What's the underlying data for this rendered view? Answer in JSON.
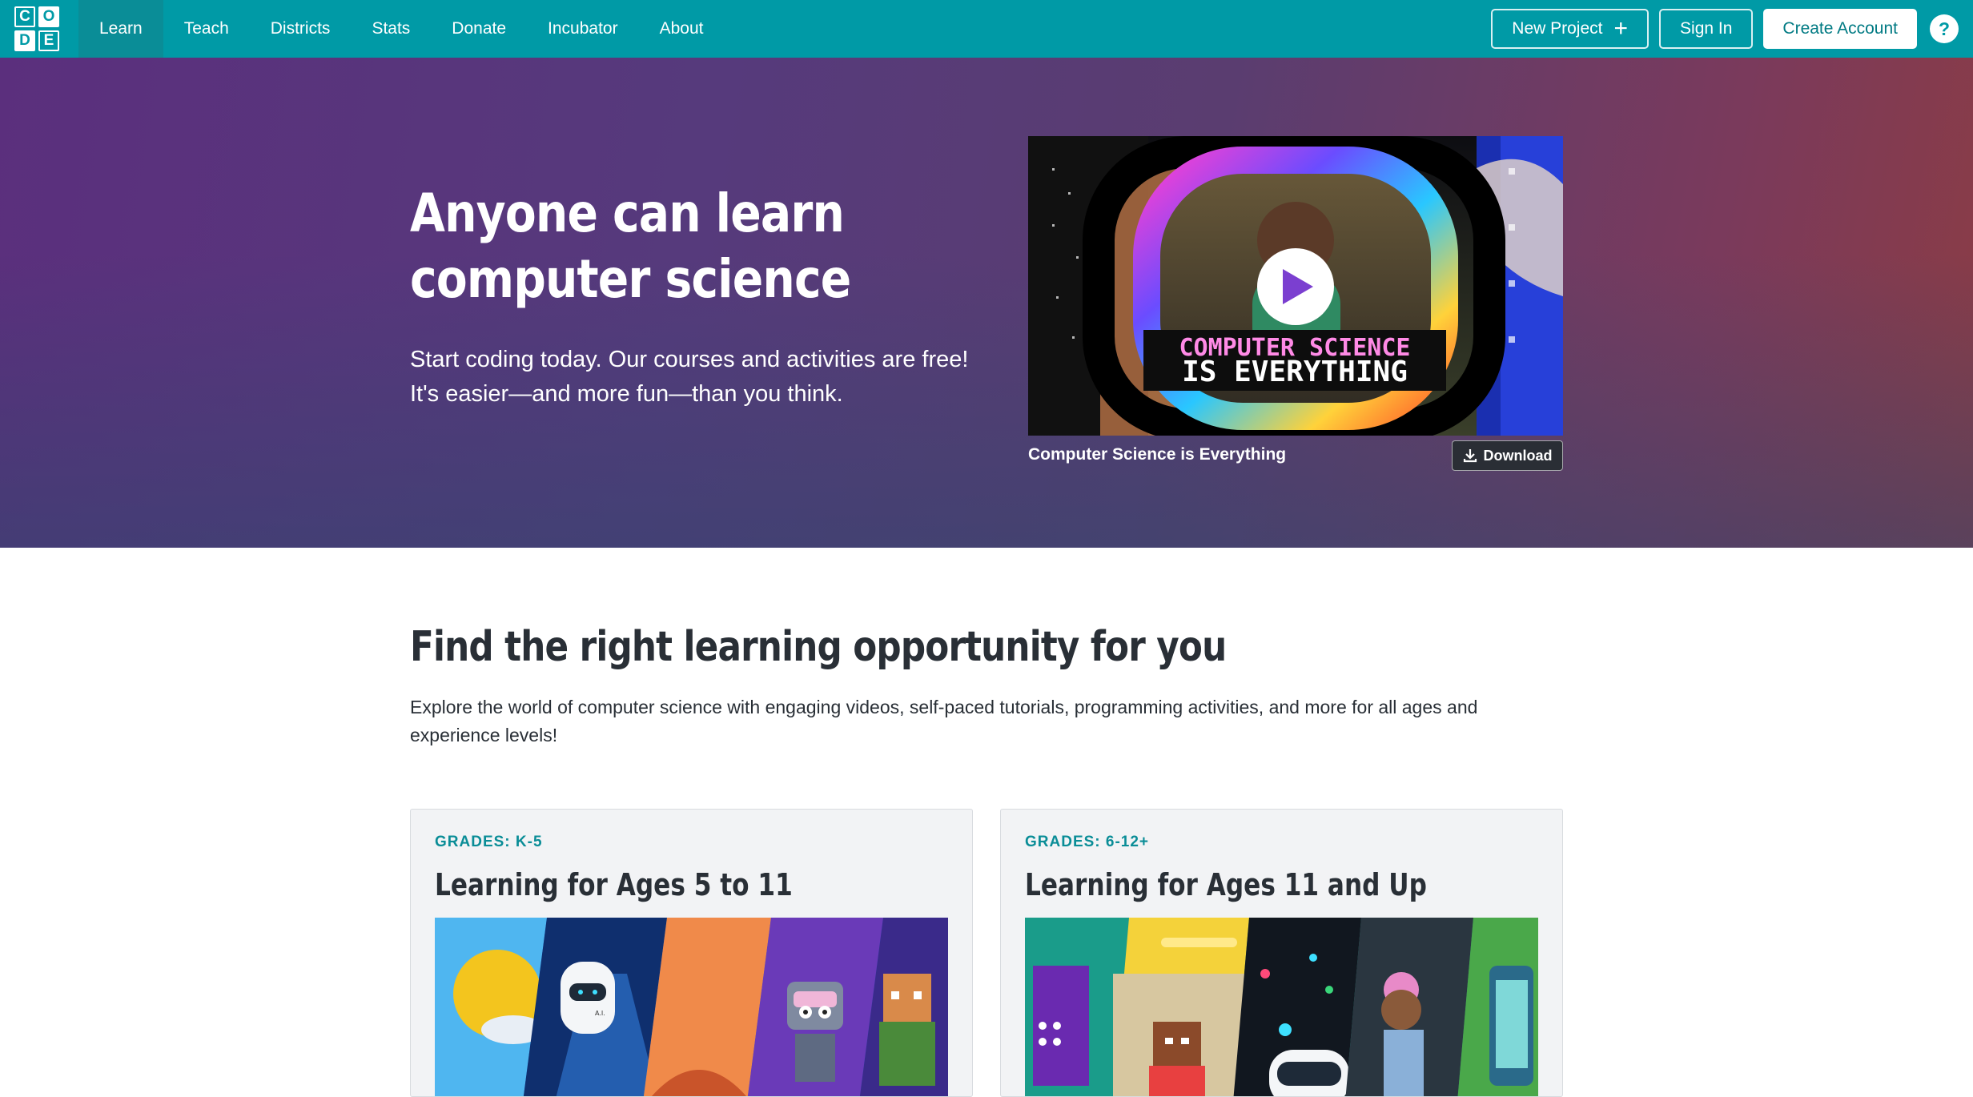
{
  "nav": {
    "logo_letters": [
      "C",
      "O",
      "D",
      "E"
    ],
    "links": [
      {
        "label": "Learn",
        "active": true
      },
      {
        "label": "Teach"
      },
      {
        "label": "Districts"
      },
      {
        "label": "Stats"
      },
      {
        "label": "Donate"
      },
      {
        "label": "Incubator"
      },
      {
        "label": "About"
      }
    ],
    "new_project": "New Project",
    "sign_in": "Sign In",
    "create_account": "Create Account",
    "help": "?",
    "bar_color": "#009aa6"
  },
  "hero": {
    "title_line1": "Anyone can learn",
    "title_line2": "computer science",
    "subtitle": "Start coding today. Our courses and activities are free! It's easier—and more fun—than you think.",
    "video_overlay_line1": "COMPUTER SCIENCE",
    "video_overlay_line2": "IS EVERYTHING",
    "video_caption": "Computer Science is Everything",
    "download_label": "Download"
  },
  "section": {
    "title": "Find the right learning opportunity for you",
    "description": "Explore the world of computer science with engaging videos, self-paced tutorials, programming activities, and more for all ages and experience levels!"
  },
  "cards": [
    {
      "grade": "GRADES: K-5",
      "title": "Learning for Ages 5 to 11",
      "image_label": "A.I."
    },
    {
      "grade": "GRADES: 6-12+",
      "title": "Learning for Ages 11 and Up"
    }
  ]
}
